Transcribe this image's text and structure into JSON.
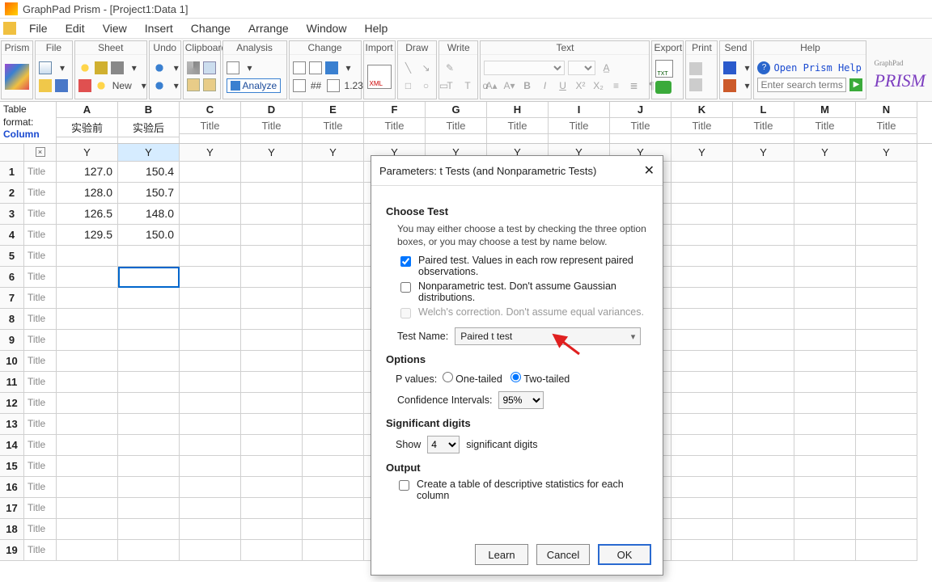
{
  "window": {
    "title": "GraphPad Prism - [Project1:Data 1]"
  },
  "menu": [
    "File",
    "Edit",
    "View",
    "Insert",
    "Change",
    "Arrange",
    "Window",
    "Help"
  ],
  "ribbon": {
    "prism": "Prism",
    "file": "File",
    "sheet": "Sheet",
    "undo": "Undo",
    "clipboard": "Clipboard",
    "analysis": "Analysis",
    "change": "Change",
    "import": "Import",
    "draw": "Draw",
    "write": "Write",
    "text": "Text",
    "export": "Export",
    "print": "Print",
    "send": "Send",
    "help": "Help",
    "analyze_btn": "Analyze",
    "new_btn": "New",
    "open_help": "Open Prism Help",
    "search_placeholder": "Enter search terms"
  },
  "table_format": {
    "label": "Table format:",
    "type": "Column"
  },
  "columns": {
    "letters": [
      "A",
      "B",
      "C",
      "D",
      "E",
      "F",
      "G",
      "H",
      "I",
      "J",
      "K",
      "L",
      "M",
      "N"
    ],
    "titles": [
      "实验前",
      "实验后",
      "Title",
      "Title",
      "Title",
      "Title",
      "Title",
      "Title",
      "Title",
      "Title",
      "Title",
      "Title",
      "Title",
      "Title"
    ]
  },
  "y_label": "Y",
  "rows": [
    {
      "n": "1",
      "title": "Title",
      "a": "127.0",
      "b": "150.4"
    },
    {
      "n": "2",
      "title": "Title",
      "a": "128.0",
      "b": "150.7"
    },
    {
      "n": "3",
      "title": "Title",
      "a": "126.5",
      "b": "148.0"
    },
    {
      "n": "4",
      "title": "Title",
      "a": "129.5",
      "b": "150.0"
    },
    {
      "n": "5",
      "title": "Title",
      "a": "",
      "b": ""
    },
    {
      "n": "6",
      "title": "Title",
      "a": "",
      "b": ""
    },
    {
      "n": "7",
      "title": "Title",
      "a": "",
      "b": ""
    },
    {
      "n": "8",
      "title": "Title",
      "a": "",
      "b": ""
    },
    {
      "n": "9",
      "title": "Title",
      "a": "",
      "b": ""
    },
    {
      "n": "10",
      "title": "Title",
      "a": "",
      "b": ""
    },
    {
      "n": "11",
      "title": "Title",
      "a": "",
      "b": ""
    },
    {
      "n": "12",
      "title": "Title",
      "a": "",
      "b": ""
    },
    {
      "n": "13",
      "title": "Title",
      "a": "",
      "b": ""
    },
    {
      "n": "14",
      "title": "Title",
      "a": "",
      "b": ""
    },
    {
      "n": "15",
      "title": "Title",
      "a": "",
      "b": ""
    },
    {
      "n": "16",
      "title": "Title",
      "a": "",
      "b": ""
    },
    {
      "n": "17",
      "title": "Title",
      "a": "",
      "b": ""
    },
    {
      "n": "18",
      "title": "Title",
      "a": "",
      "b": ""
    },
    {
      "n": "19",
      "title": "Title",
      "a": "",
      "b": ""
    }
  ],
  "dialog": {
    "title": "Parameters: t Tests (and Nonparametric Tests)",
    "choose_test": "Choose Test",
    "desc": "You may either choose a test by checking the three option boxes, or you may choose a test by name below.",
    "cb_paired": "Paired test. Values in each row represent paired observations.",
    "cb_nonparam": "Nonparametric test. Don't assume Gaussian distributions.",
    "cb_welch": "Welch's correction. Don't assume equal variances.",
    "test_name_label": "Test Name:",
    "test_name_value": "Paired t test",
    "options": "Options",
    "pvalues_label": "P values:",
    "one_tailed": "One-tailed",
    "two_tailed": "Two-tailed",
    "ci_label": "Confidence Intervals:",
    "ci_value": "95%",
    "sig_digits": "Significant digits",
    "show": "Show",
    "sig_val": "4",
    "sig_suffix": "significant digits",
    "output": "Output",
    "output_cb": "Create a table of descriptive statistics for each column",
    "learn": "Learn",
    "cancel": "Cancel",
    "ok": "OK"
  },
  "brand": {
    "top": "GraphPad",
    "name": "PRISM"
  }
}
